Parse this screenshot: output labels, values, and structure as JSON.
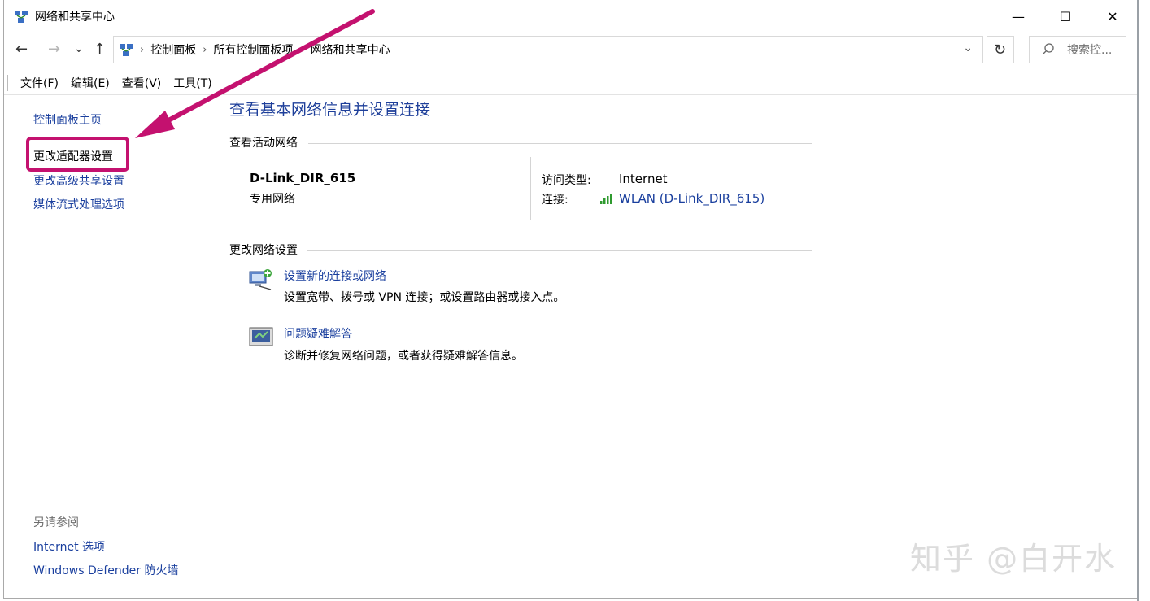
{
  "window": {
    "title": "网络和共享中心",
    "controls": {
      "minimize": "—",
      "maximize": "☐",
      "close": "✕"
    }
  },
  "nav": {
    "back": "←",
    "forward": "→",
    "recent": "⌄",
    "up": "↑",
    "breadcrumbs": [
      "控制面板",
      "所有控制面板项",
      "网络和共享中心"
    ],
    "separator": "›",
    "dropdown": "⌄",
    "refresh": "↻"
  },
  "search": {
    "placeholder": "搜索控..."
  },
  "menu": [
    "文件(F)",
    "编辑(E)",
    "查看(V)",
    "工具(T)"
  ],
  "sidebar": {
    "home": "控制面板主页",
    "links": [
      "更改适配器设置",
      "更改高级共享设置",
      "媒体流式处理选项"
    ],
    "see_also_heading": "另请参阅",
    "see_also": [
      "Internet 选项",
      "Windows Defender 防火墙"
    ]
  },
  "main": {
    "title": "查看基本网络信息并设置连接",
    "active_networks_heading": "查看活动网络",
    "network": {
      "name": "D-Link_DIR_615",
      "type": "专用网络",
      "access_type_label": "访问类型:",
      "access_type_value": "Internet",
      "connection_label": "连接:",
      "connection_value": "WLAN (D-Link_DIR_615)"
    },
    "change_settings_heading": "更改网络设置",
    "tasks": [
      {
        "title": "设置新的连接或网络",
        "desc": "设置宽带、拨号或 VPN 连接；或设置路由器或接入点。",
        "icon": "network-setup-icon"
      },
      {
        "title": "问题疑难解答",
        "desc": "诊断并修复网络问题，或者获得疑难解答信息。",
        "icon": "troubleshoot-icon"
      }
    ]
  },
  "annotation": {
    "color": "#c4116f"
  },
  "watermark": "知乎 @白开水",
  "colors": {
    "link": "#1a3f9e",
    "title": "#1e3f9a",
    "annotation": "#c4116f"
  }
}
